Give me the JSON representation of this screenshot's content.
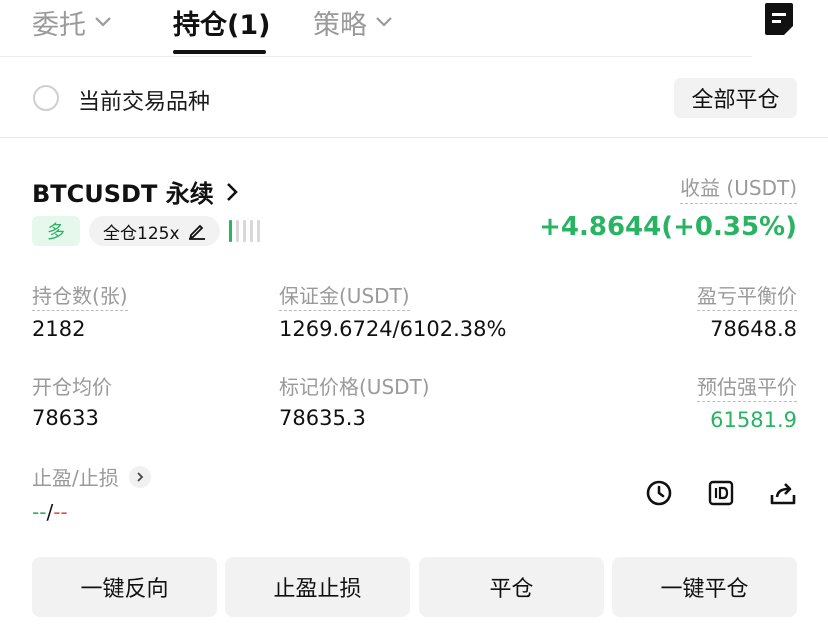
{
  "tabs": [
    {
      "label": "委托",
      "active": false,
      "has_dropdown": true
    },
    {
      "label": "持仓(1)",
      "active": true,
      "has_dropdown": false
    },
    {
      "label": "策略",
      "active": false,
      "has_dropdown": true
    }
  ],
  "header_icon": "document-icon",
  "filter": {
    "label": "当前交易品种",
    "checked": false,
    "close_all_label": "全部平仓"
  },
  "position": {
    "symbol": "BTCUSDT 永续",
    "side_tag": "多",
    "leverage_tag": "全仓125x",
    "risk_level": {
      "filled": 1,
      "total": 5
    },
    "pnl_label": "收益 (USDT)",
    "pnl_value": "+4.8644(+0.35%)",
    "stats": {
      "size_label": "持仓数(张)",
      "size_value": "2182",
      "margin_label": "保证金(USDT)",
      "margin_value": "1269.6724/6102.38%",
      "breakeven_label": "盈亏平衡价",
      "breakeven_value": "78648.8",
      "entry_label": "开仓均价",
      "entry_value": "78633",
      "mark_label": "标记价格(USDT)",
      "mark_value": "78635.3",
      "liq_label": "预估强平价",
      "liq_value": "61581.9"
    },
    "tpsl_label": "止盈/止损",
    "tpsl_tp": "--",
    "tpsl_sep": "/",
    "tpsl_sl": "--"
  },
  "action_icons": [
    "clock-icon",
    "id-icon",
    "share-icon"
  ],
  "buttons": [
    {
      "label": "一键反向"
    },
    {
      "label": "止盈止损"
    },
    {
      "label": "平仓"
    },
    {
      "label": "一键平仓"
    }
  ],
  "colors": {
    "green": "#28b463",
    "red": "#e84d4d",
    "gray_text": "#9a9a9a"
  }
}
